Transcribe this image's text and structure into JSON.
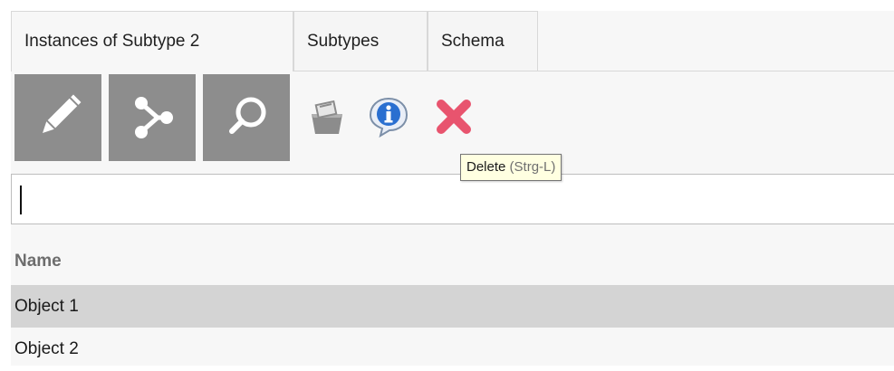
{
  "tabs": [
    {
      "label": "Instances of Subtype 2",
      "active": true
    },
    {
      "label": "Subtypes",
      "active": false
    },
    {
      "label": "Schema",
      "active": false
    }
  ],
  "toolbar": {
    "buttons": [
      {
        "icon": "pencil-icon"
      },
      {
        "icon": "graph-icon"
      },
      {
        "icon": "search-icon"
      },
      {
        "icon": "clipboard-icon"
      },
      {
        "icon": "info-icon"
      },
      {
        "icon": "delete-icon",
        "color": "#e8546e"
      }
    ]
  },
  "tooltip": {
    "label": "Delete",
    "shortcut": "(Strg-L)"
  },
  "search": {
    "value": ""
  },
  "list": {
    "header": "Name",
    "rows": [
      {
        "label": "Object 1",
        "selected": true
      },
      {
        "label": "Object 2",
        "selected": false
      }
    ]
  },
  "colors": {
    "big_button_bg": "#8d8d8d",
    "selected_row": "#d4d4d4",
    "tooltip_bg": "#ffffe1",
    "delete_accent": "#e8546e",
    "info_blue": "#2a6fd0"
  }
}
